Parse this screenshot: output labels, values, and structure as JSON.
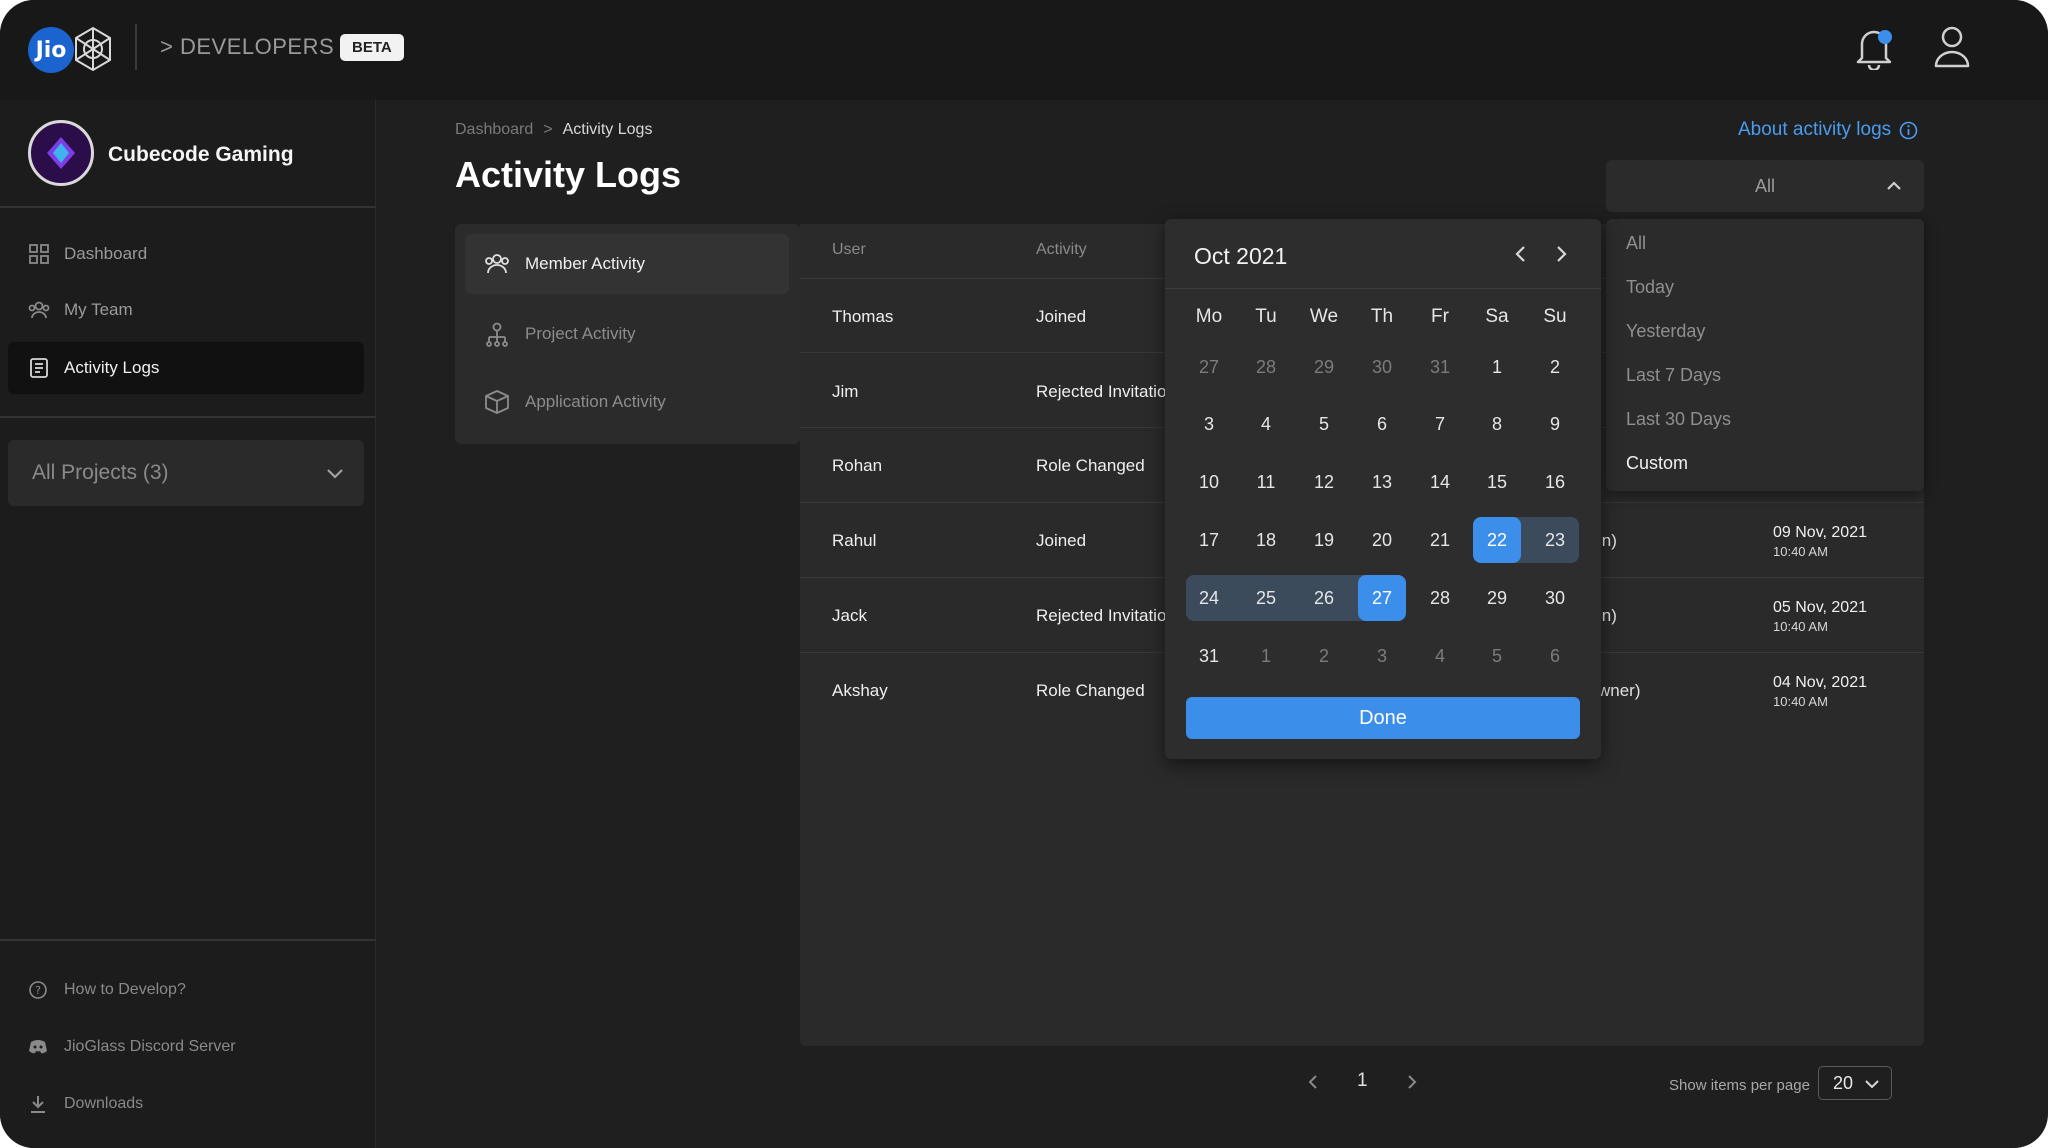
{
  "header": {
    "logo_text": "Jio",
    "developers_label": "DEVELOPERS",
    "developers_prefix": ">",
    "beta_label": "BETA",
    "icons": [
      "jio-logo",
      "mesh-logo-icon",
      "bell-icon",
      "user-icon"
    ]
  },
  "sidebar": {
    "org_name": "Cubecode Gaming",
    "items": [
      {
        "label": "Dashboard",
        "icon": "grid-icon"
      },
      {
        "label": "My Team",
        "icon": "team-icon"
      },
      {
        "label": "Activity Logs",
        "icon": "logs-icon",
        "active": true
      }
    ],
    "projects_select": "All Projects (3)",
    "footer": [
      {
        "label": "How to Develop?",
        "icon": "help-icon"
      },
      {
        "label": "JioGlass Discord Server",
        "icon": "discord-icon"
      },
      {
        "label": "Downloads",
        "icon": "download-icon"
      }
    ]
  },
  "breadcrumb": {
    "parent": "Dashboard",
    "separator": ">",
    "current": "Activity Logs"
  },
  "page_title": "Activity Logs",
  "about_link": "About activity logs",
  "filter": {
    "selected": "All",
    "options": [
      "All",
      "Today",
      "Yesterday",
      "Last 7 Days",
      "Last 30 Days",
      "Custom"
    ],
    "highlighted": "Custom"
  },
  "tabs": [
    {
      "label": "Member Activity",
      "icon": "members-icon",
      "active": true
    },
    {
      "label": "Project Activity",
      "icon": "project-icon"
    },
    {
      "label": "Application Activity",
      "icon": "box-icon"
    }
  ],
  "table": {
    "headers": [
      "User",
      "Activity"
    ],
    "rows": [
      {
        "user": "Thomas",
        "activity": "Joined",
        "detail": "",
        "date": "",
        "time": ""
      },
      {
        "user": "Jim",
        "activity": "Rejected Invitatio",
        "detail": "",
        "date": "",
        "time": ""
      },
      {
        "user": "Rohan",
        "activity": "Role Changed",
        "detail": "",
        "date": "",
        "time": ""
      },
      {
        "user": "Rahul",
        "activity": "Joined",
        "detail": "in)",
        "date": "09 Nov, 2021",
        "time": "10:40 AM"
      },
      {
        "user": "Jack",
        "activity": "Rejected Invitatio",
        "detail": "in)",
        "date": "05 Nov, 2021",
        "time": "10:40 AM"
      },
      {
        "user": "Akshay",
        "activity": "Role Changed",
        "detail": "wner)",
        "date": "04 Nov, 2021",
        "time": "10:40 AM"
      }
    ]
  },
  "calendar": {
    "month_label": "Oct 2021",
    "weekdays": [
      "Mo",
      "Tu",
      "We",
      "Th",
      "Fr",
      "Sa",
      "Su"
    ],
    "weeks": [
      [
        "27",
        "28",
        "29",
        "30",
        "31",
        "1",
        "2"
      ],
      [
        "3",
        "4",
        "5",
        "6",
        "7",
        "8",
        "9"
      ],
      [
        "10",
        "11",
        "12",
        "13",
        "14",
        "15",
        "16"
      ],
      [
        "17",
        "18",
        "19",
        "20",
        "21",
        "22",
        "23"
      ],
      [
        "24",
        "25",
        "26",
        "27",
        "28",
        "29",
        "30"
      ],
      [
        "31",
        "1",
        "2",
        "3",
        "4",
        "5",
        "6"
      ]
    ],
    "range_start": "22",
    "range_end": "27",
    "done_label": "Done"
  },
  "pagination": {
    "current_page": "1",
    "per_page_label": "Show items per page",
    "per_page": "20"
  },
  "colors": {
    "accent": "#3b8eea",
    "link": "#4a9cf0",
    "background": "#1f1f1f",
    "panel": "#2a2a2a"
  }
}
